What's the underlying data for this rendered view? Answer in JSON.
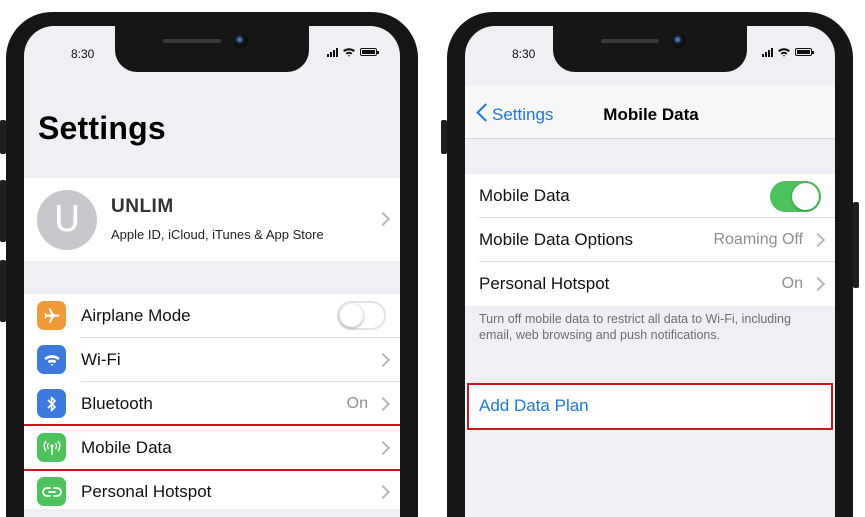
{
  "colors": {
    "accent": "#1a7ae0",
    "highlight": "#d0141b",
    "toggle_on": "#4cc35a"
  },
  "left_screen": {
    "status_time": "8:30",
    "title": "Settings",
    "profile": {
      "initial": "U",
      "name": "UNLIM",
      "subtitle": "Apple ID, iCloud, iTunes & App Store"
    },
    "items": [
      {
        "label": "Airplane Mode",
        "icon": "airplane-icon",
        "color": "#f19a37",
        "control": "toggle-off"
      },
      {
        "label": "Wi-Fi",
        "icon": "wifi-icon",
        "color": "#3d7ae0",
        "control": "chevron"
      },
      {
        "label": "Bluetooth",
        "icon": "bluetooth-icon",
        "color": "#3d7ae0",
        "detail": "On",
        "control": "chevron"
      },
      {
        "label": "Mobile Data",
        "icon": "antenna-icon",
        "color": "#4cc35a",
        "control": "chevron",
        "highlighted": true
      },
      {
        "label": "Personal Hotspot",
        "icon": "hotspot-icon",
        "color": "#4cc35a",
        "control": "chevron"
      }
    ]
  },
  "right_screen": {
    "status_time": "8:30",
    "nav": {
      "back_label": "Settings",
      "title": "Mobile Data"
    },
    "items": [
      {
        "label": "Mobile Data",
        "control": "toggle-on"
      },
      {
        "label": "Mobile Data Options",
        "detail": "Roaming Off",
        "control": "chevron"
      },
      {
        "label": "Personal Hotspot",
        "detail": "On",
        "control": "chevron"
      }
    ],
    "footer_note": "Turn off mobile data to restrict all data to Wi-Fi, including email, web browsing and push notifications.",
    "add_data_plan": "Add Data Plan"
  }
}
